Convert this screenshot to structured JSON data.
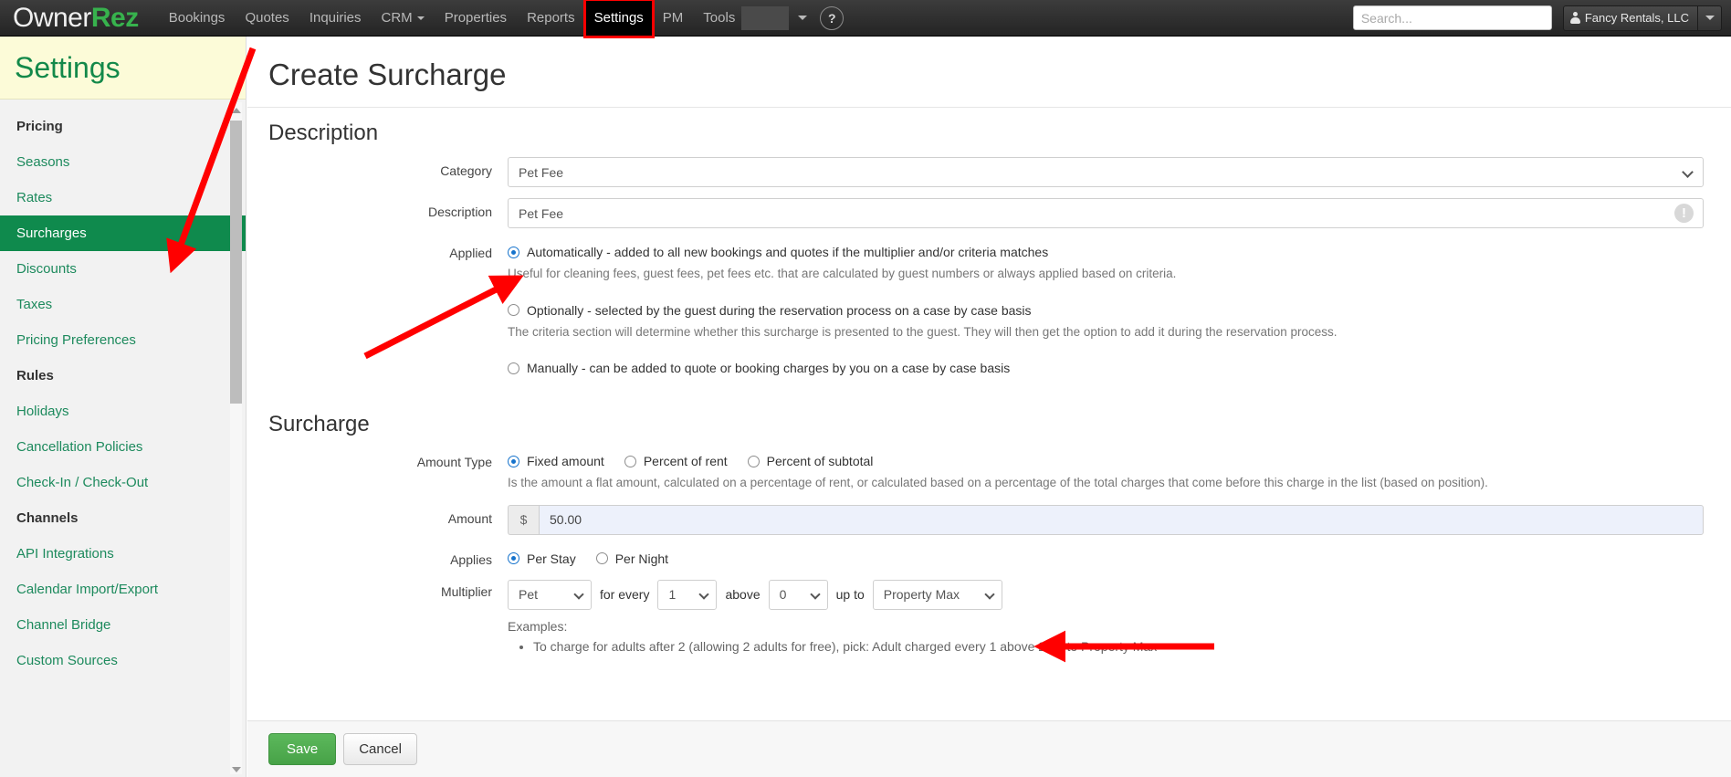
{
  "navbar": {
    "brand_owner": "Owner",
    "brand_rez": "Rez",
    "items": [
      {
        "label": "Bookings",
        "caret": false,
        "active": false
      },
      {
        "label": "Quotes",
        "caret": false,
        "active": false
      },
      {
        "label": "Inquiries",
        "caret": false,
        "active": false
      },
      {
        "label": "CRM",
        "caret": true,
        "active": false
      },
      {
        "label": "Properties",
        "caret": false,
        "active": false
      },
      {
        "label": "Reports",
        "caret": false,
        "active": false
      },
      {
        "label": "Settings",
        "caret": false,
        "active": true
      },
      {
        "label": "PM",
        "caret": false,
        "active": false
      },
      {
        "label": "Tools",
        "caret": false,
        "active": false
      }
    ],
    "help_label": "?",
    "search_placeholder": "Search...",
    "search_value": "",
    "account_name": "Fancy Rentals, LLC"
  },
  "sidebar": {
    "title": "Settings",
    "items": [
      {
        "label": "Pricing",
        "type": "group"
      },
      {
        "label": "Seasons",
        "type": "link"
      },
      {
        "label": "Rates",
        "type": "link"
      },
      {
        "label": "Surcharges",
        "type": "link",
        "active": true
      },
      {
        "label": "Discounts",
        "type": "link"
      },
      {
        "label": "Taxes",
        "type": "link"
      },
      {
        "label": "Pricing Preferences",
        "type": "link"
      },
      {
        "label": "Rules",
        "type": "group"
      },
      {
        "label": "Holidays",
        "type": "link"
      },
      {
        "label": "Cancellation Policies",
        "type": "link"
      },
      {
        "label": "Check-In / Check-Out",
        "type": "link"
      },
      {
        "label": "Channels",
        "type": "group"
      },
      {
        "label": "API Integrations",
        "type": "link"
      },
      {
        "label": "Calendar Import/Export",
        "type": "link"
      },
      {
        "label": "Channel Bridge",
        "type": "link"
      },
      {
        "label": "Custom Sources",
        "type": "link"
      }
    ]
  },
  "page": {
    "title": "Create Surcharge",
    "description_section": {
      "heading": "Description",
      "category_label": "Category",
      "category_value": "Pet Fee",
      "description_label": "Description",
      "description_value": "Pet Fee",
      "description_warn_glyph": "!",
      "applied_label": "Applied",
      "applied_options": [
        {
          "label": "Automatically - added to all new bookings and quotes if the multiplier and/or criteria matches",
          "help": "Useful for cleaning fees, guest fees, pet fees etc. that are calculated by guest numbers or always applied based on criteria.",
          "selected": true
        },
        {
          "label": "Optionally - selected by the guest during the reservation process on a case by case basis",
          "help": "The criteria section will determine whether this surcharge is presented to the guest. They will then get the option to add it during the reservation process.",
          "selected": false
        },
        {
          "label": "Manually - can be added to quote or booking charges by you on a case by case basis",
          "help": "",
          "selected": false
        }
      ]
    },
    "surcharge_section": {
      "heading": "Surcharge",
      "amount_type_label": "Amount Type",
      "amount_type_options": [
        {
          "label": "Fixed amount",
          "selected": true
        },
        {
          "label": "Percent of rent",
          "selected": false
        },
        {
          "label": "Percent of subtotal",
          "selected": false
        }
      ],
      "amount_type_help": "Is the amount a flat amount, calculated on a percentage of rent, or calculated based on a percentage of the total charges that come before this charge in the list (based on position).",
      "amount_label": "Amount",
      "amount_currency": "$",
      "amount_value": "50.00",
      "applies_label": "Applies",
      "applies_options": [
        {
          "label": "Per Stay",
          "selected": true
        },
        {
          "label": "Per Night",
          "selected": false
        }
      ],
      "multiplier_label": "Multiplier",
      "multiplier_subject": "Pet",
      "multiplier_word_every": "for every",
      "multiplier_every": "1",
      "multiplier_word_above": "above",
      "multiplier_above": "0",
      "multiplier_word_upto": "up to",
      "multiplier_upto": "Property Max",
      "examples_label": "Examples:",
      "examples": [
        "To charge for adults after 2 (allowing 2 adults for free), pick: Adult charged every 1 above 2 up to Property Max"
      ]
    },
    "footer": {
      "save_label": "Save",
      "cancel_label": "Cancel"
    }
  },
  "annotations": {
    "color": "#ff0000",
    "arrow_count": 3
  }
}
